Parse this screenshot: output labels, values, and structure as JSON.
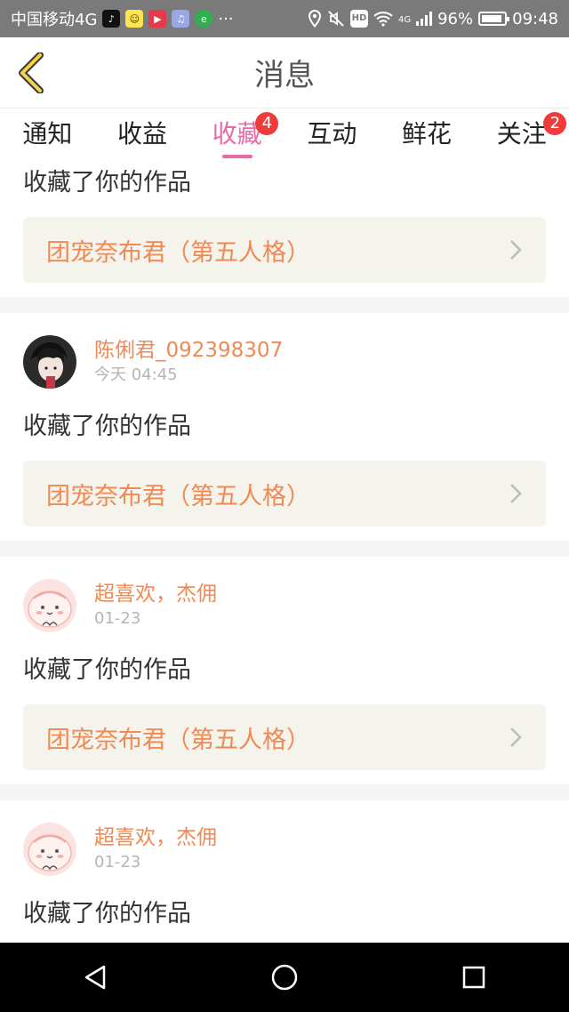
{
  "status_bar": {
    "carrier": "中国移动4G",
    "more": "···",
    "network": "4G",
    "battery": "96%",
    "time": "09:48",
    "app_icons": [
      "tiktok-icon",
      "chat-icon",
      "video-icon",
      "music-icon",
      "browser-icon"
    ]
  },
  "header": {
    "title": "消息"
  },
  "tabs": [
    {
      "label": "通知",
      "badge": ""
    },
    {
      "label": "收益",
      "badge": ""
    },
    {
      "label": "收藏",
      "badge": "4",
      "active": true
    },
    {
      "label": "互动",
      "badge": ""
    },
    {
      "label": "鲜花",
      "badge": ""
    },
    {
      "label": "关注",
      "badge": "2"
    }
  ],
  "messages": [
    {
      "action": "收藏了你的作品",
      "work": "团宠奈布君（第五人格）"
    },
    {
      "user": "陈俐君_092398307",
      "time": "今天 04:45",
      "action": "收藏了你的作品",
      "work": "团宠奈布君（第五人格）"
    },
    {
      "user": "超喜欢，杰佣",
      "time": "01-23",
      "action": "收藏了你的作品",
      "work": "团宠奈布君（第五人格）"
    },
    {
      "user": "超喜欢，杰佣",
      "time": "01-23",
      "action": "收藏了你的作品"
    }
  ],
  "colors": {
    "accent": "#e86ba6",
    "username": "#f08a55",
    "badge": "#ef3b3b",
    "work_box": "#f4f3ec"
  }
}
